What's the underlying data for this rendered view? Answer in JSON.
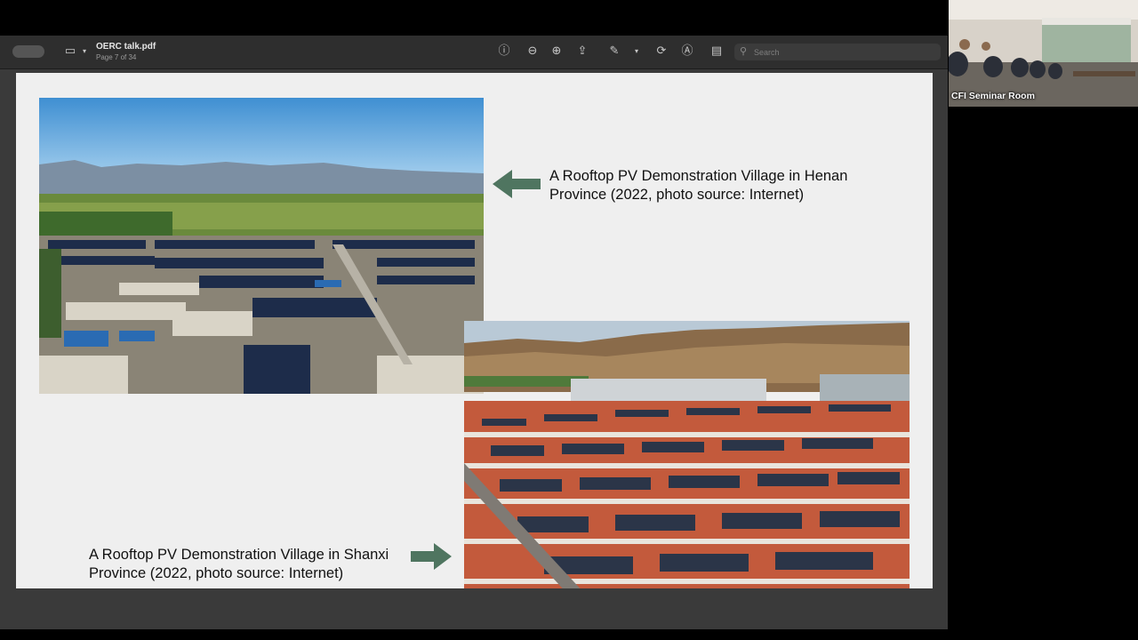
{
  "viewer": {
    "file_name": "OERC talk.pdf",
    "page_info": "Page 7 of 34",
    "search_placeholder": "Search"
  },
  "toolbar_icons": [
    "sidebar-icon",
    "info-icon",
    "zoom-out-icon",
    "zoom-in-icon",
    "share-icon",
    "markup-pen-icon",
    "rotate-icon",
    "markup-icon",
    "form-icon",
    "search-icon"
  ],
  "slide": {
    "caption_top": {
      "line1": "A Rooftop PV Demonstration Village in Henan",
      "line2": "Province (2022, photo source: Internet)"
    },
    "caption_bottom": {
      "line1": "A Rooftop PV Demonstration Village in Shanxi",
      "line2": "Province (2022, photo source: Internet)"
    },
    "arrow_color": "#4f7560"
  },
  "webcam": {
    "label": "CFI Seminar Room"
  }
}
